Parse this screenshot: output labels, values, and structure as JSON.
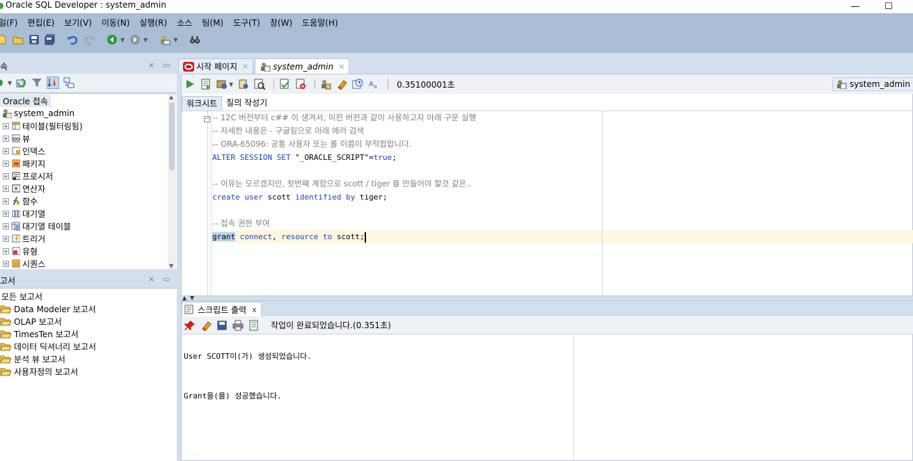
{
  "window": {
    "title": "Oracle SQL Developer : system_admin",
    "minimize_glyph": "—",
    "maximize_glyph": "☐"
  },
  "menu": [
    "일(F)",
    "편집(E)",
    "보기(V)",
    "이동(N)",
    "실행(R)",
    "소스",
    "팀(M)",
    "도구(T)",
    "창(W)",
    "도움말(H)"
  ],
  "connections_pane": {
    "title": "속",
    "root_label": "Oracle 접속",
    "connection": "system_admin",
    "nodes": [
      "테이블(필터링됨)",
      "뷰",
      "인덱스",
      "패키지",
      "프로시저",
      "연산자",
      "함수",
      "대기열",
      "대기열 테이블",
      "트리거",
      "유형",
      "시퀀스"
    ]
  },
  "reports_pane": {
    "title": "고서",
    "items": [
      "모든 보고서",
      "Data Modeler 보고서",
      "OLAP 보고서",
      "TimesTen 보고서",
      "데이터 딕셔너리 보고서",
      "분석 뷰 보고서",
      "사용자정의 보고서"
    ]
  },
  "editor": {
    "tabs": [
      {
        "label": "시작 페이지",
        "close": "×"
      },
      {
        "label": "system_admin",
        "close": "×"
      }
    ],
    "elapsed": "0.35100001초",
    "connection_select": "system_admin",
    "subtabs": [
      "워크시트",
      "질의 작성기"
    ],
    "code": {
      "l1": "-- 12C 버전부터 c## 이 생겨서, 이전 버전과 같이 사용하고자 아래 구문 실행",
      "l2": "-- 자세한 내용은 - 구글링으로 아래 에러 검색",
      "l3": "-- ORA-65096: 공통 사용자 또는 롤 이름이 부적합합니다.",
      "l4_kw": "ALTER SESSION SET",
      "l4_rest": " \"_ORACLE_SCRIPT\"=",
      "l4_val": "true",
      "l4_end": ";",
      "l6": "-- 이유는 모르겠지만, 첫번째 계정으로 scott / tiger 를 만들어야 할것 같은..",
      "l7_kw1": "create user",
      "l7_a": " scott ",
      "l7_kw2": "identified by",
      "l7_b": " tiger;",
      "l9": "-- 접속 권한 부여",
      "l10_sel": "grant",
      "l10_kw": " connect",
      "l10_c": ",",
      "l10_kw2": " resource",
      "l10_kw3": " to",
      "l10_end": " scott;",
      "fold": "−"
    }
  },
  "output": {
    "tab_label": "스크립트 출력",
    "tab_close": "x",
    "status": "작업이 완료되었습니다.(0.351초)",
    "lines": [
      "User SCOTT이(가) 생성되었습니다.",
      "Grant을(를) 성공했습니다."
    ]
  }
}
